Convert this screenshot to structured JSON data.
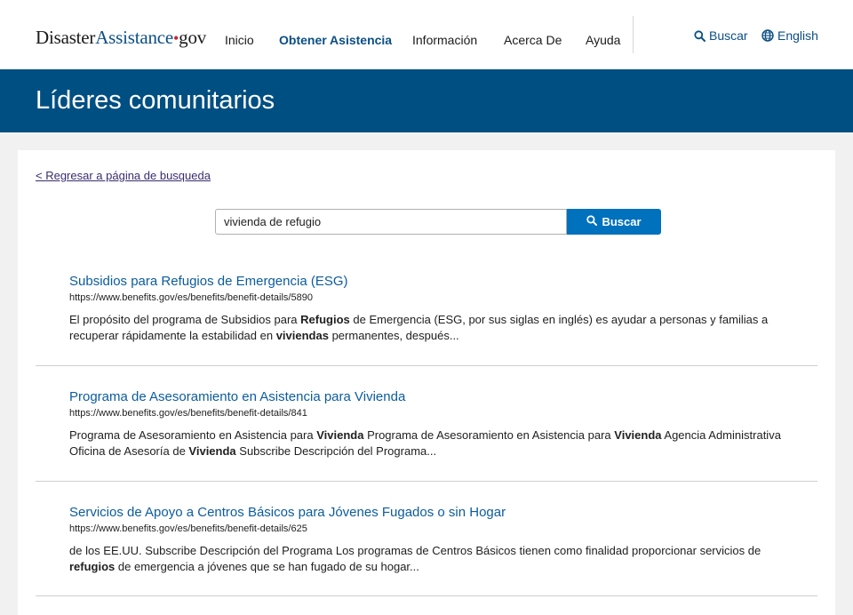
{
  "header": {
    "logo": {
      "part1": "Disaster",
      "part2": "Assistance",
      "dot": "•",
      "part3": "gov"
    },
    "nav": [
      {
        "label": "Inicio",
        "active": false
      },
      {
        "label": "Obtener Asistencia",
        "active": true
      },
      {
        "label": "Información",
        "active": false
      },
      {
        "label": "Acerca De",
        "active": false
      },
      {
        "label": "Ayuda",
        "active": false
      }
    ],
    "search_label": "Buscar",
    "language_label": "English"
  },
  "banner": {
    "title": "Líderes comunitarios"
  },
  "main": {
    "back_link": "< Regresar a página de busqueda",
    "search": {
      "value": "vivienda de refugio",
      "button_label": "Buscar"
    },
    "results": [
      {
        "title": "Subsidios para Refugios de Emergencia (ESG)",
        "url": "https://www.benefits.gov/es/benefits/benefit-details/5890",
        "desc": [
          {
            "t": "El propósito del programa de Subsidios para ",
            "b": false
          },
          {
            "t": "Refugios",
            "b": true
          },
          {
            "t": " de Emergencia (ESG, por sus siglas en inglés) es ayudar a personas y familias a recuperar rápidamente la estabilidad en ",
            "b": false
          },
          {
            "t": "viviendas",
            "b": true
          },
          {
            "t": " permanentes, después...",
            "b": false
          }
        ]
      },
      {
        "title": "Programa de Asesoramiento en Asistencia para Vivienda",
        "url": "https://www.benefits.gov/es/benefits/benefit-details/841",
        "desc": [
          {
            "t": "Programa de Asesoramiento en Asistencia para ",
            "b": false
          },
          {
            "t": "Vivienda",
            "b": true
          },
          {
            "t": " Programa de Asesoramiento en Asistencia para ",
            "b": false
          },
          {
            "t": "Vivienda",
            "b": true
          },
          {
            "t": " Agencia Administrativa Oficina de Asesoría de ",
            "b": false
          },
          {
            "t": "Vivienda",
            "b": true
          },
          {
            "t": " Subscribe Descripción del Programa...",
            "b": false
          }
        ]
      },
      {
        "title": "Servicios de Apoyo a Centros Básicos para Jóvenes Fugados o sin Hogar",
        "url": "https://www.benefits.gov/es/benefits/benefit-details/625",
        "desc": [
          {
            "t": "de los EE.UU. Subscribe Descripción del Programa Los programas de Centros Básicos tienen como finalidad proporcionar servicios de ",
            "b": false
          },
          {
            "t": "refugios",
            "b": true
          },
          {
            "t": " de emergencia a jóvenes que se han fugado de su hogar...",
            "b": false
          }
        ]
      }
    ]
  },
  "colors": {
    "brand_blue": "#004f83",
    "link_blue": "#0b5c9e",
    "button_blue": "#0071bc",
    "logo_dot_red": "#cc2233"
  }
}
